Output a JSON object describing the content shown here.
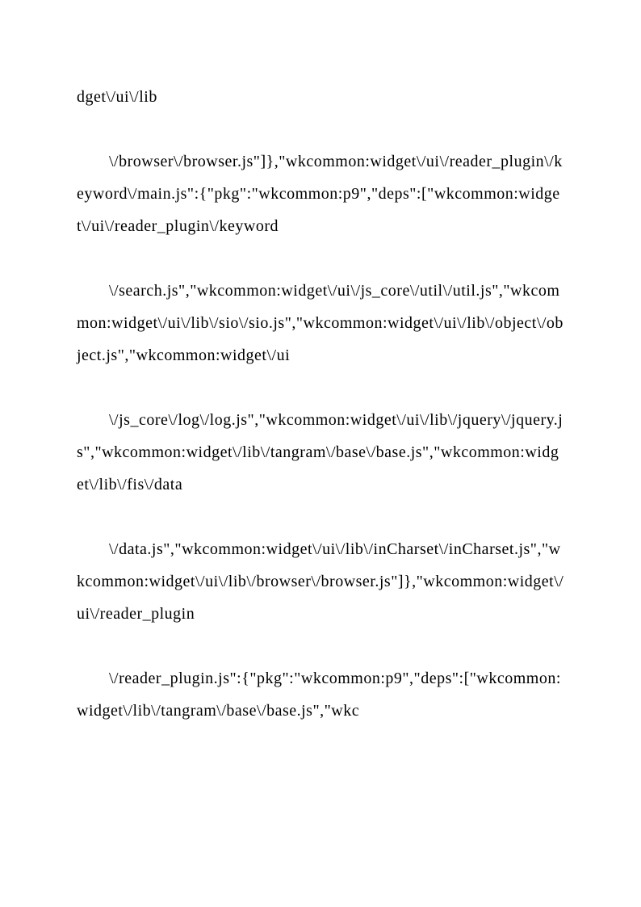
{
  "paragraphs": [
    "dget\\/ui\\/lib",
    "\\/browser\\/browser.js\"]},\"wkcommon:widget\\/ui\\/reader_plugin\\/keyword\\/main.js\":{\"pkg\":\"wkcommon:p9\",\"deps\":[\"wkcommon:widget\\/ui\\/reader_plugin\\/keyword",
    "\\/search.js\",\"wkcommon:widget\\/ui\\/js_core\\/util\\/util.js\",\"wkcommon:widget\\/ui\\/lib\\/sio\\/sio.js\",\"wkcommon:widget\\/ui\\/lib\\/object\\/object.js\",\"wkcommon:widget\\/ui",
    "\\/js_core\\/log\\/log.js\",\"wkcommon:widget\\/ui\\/lib\\/jquery\\/jquery.js\",\"wkcommon:widget\\/lib\\/tangram\\/base\\/base.js\",\"wkcommon:widget\\/lib\\/fis\\/data",
    "\\/data.js\",\"wkcommon:widget\\/ui\\/lib\\/inCharset\\/inCharset.js\",\"wkcommon:widget\\/ui\\/lib\\/browser\\/browser.js\"]},\"wkcommon:widget\\/ui\\/reader_plugin",
    "\\/reader_plugin.js\":{\"pkg\":\"wkcommon:p9\",\"deps\":[\"wkcommon:widget\\/lib\\/tangram\\/base\\/base.js\",\"wkc"
  ]
}
